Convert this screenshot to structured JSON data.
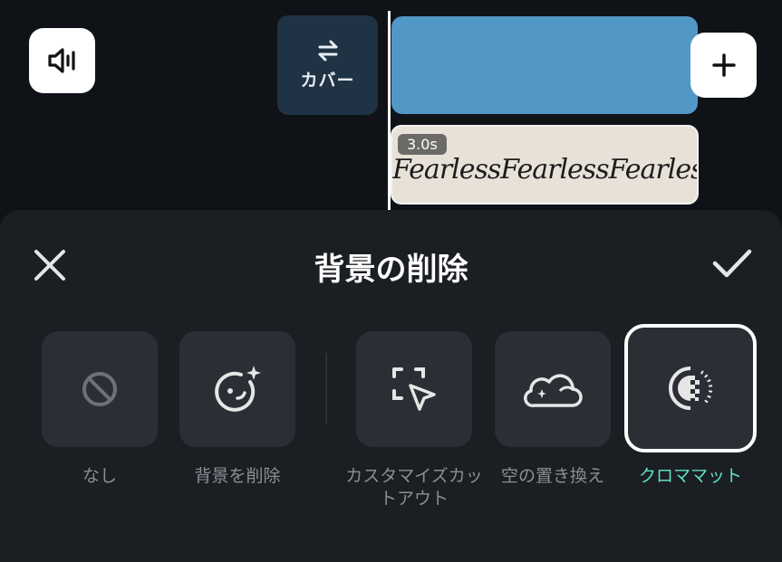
{
  "timeline": {
    "cover_label": "カバー",
    "clip_duration": "3.0s",
    "clip_text": "FearlessFearlessFearlessFearless"
  },
  "panel": {
    "title": "背景の削除",
    "options": [
      {
        "label": "なし",
        "icon": "no-symbol-icon"
      },
      {
        "label": "背景を削除",
        "icon": "face-sparkle-icon"
      },
      {
        "label": "カスタマイズカットアウト",
        "icon": "cursor-select-icon"
      },
      {
        "label": "空の置き換え",
        "icon": "cloud-sparkle-icon"
      },
      {
        "label": "クロママット",
        "icon": "chroma-icon",
        "selected": true
      }
    ]
  },
  "colors": {
    "accent": "#5ee0c2",
    "track_blue": "#5298c6",
    "panel_bg": "#1b1e23"
  }
}
